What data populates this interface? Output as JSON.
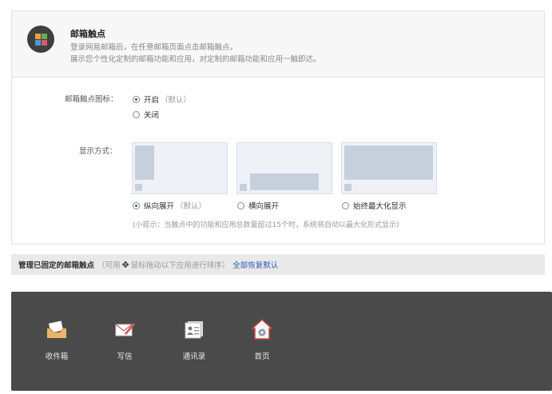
{
  "header": {
    "title": "邮箱触点",
    "desc_line1": "登录网易邮箱后，在任意邮箱页面点击邮箱触点，",
    "desc_line2": "展示您个性化定制的邮箱功能和应用，对定制的邮箱功能和应用一触即达。"
  },
  "icon_setting": {
    "label": "邮箱触点图标：",
    "options": [
      {
        "label": "开启",
        "hint": "（默认）",
        "selected": true
      },
      {
        "label": "关闭",
        "hint": "",
        "selected": false
      }
    ]
  },
  "display_mode": {
    "label": "显示方式：",
    "options": [
      {
        "label": "纵向展开",
        "hint": "（默认）",
        "selected": true
      },
      {
        "label": "横向展开",
        "hint": "",
        "selected": false
      },
      {
        "label": "始终最大化显示",
        "hint": "",
        "selected": false
      }
    ],
    "tip": "(小提示：当触点中的功能和应用总数量超过15个时，系统将自动以最大化形式显示)"
  },
  "pinned_bar": {
    "title": "管理已固定的邮箱触点",
    "prefix": "（可用",
    "move_glyph": "✥",
    "suffix": "鼠标拖动以下应用进行排序）",
    "reset_link": "全部恢复默认"
  },
  "dock": {
    "apps": [
      {
        "label": "收件箱",
        "icon": "inbox-icon"
      },
      {
        "label": "写信",
        "icon": "compose-icon"
      },
      {
        "label": "通讯录",
        "icon": "contacts-icon"
      },
      {
        "label": "首页",
        "icon": "home-icon"
      }
    ]
  },
  "colors": {
    "accent": "#2a5db0",
    "dock_bg": "#4a4a4a",
    "preview_bg": "#eef2f7",
    "preview_shape": "#c6d0dc"
  }
}
